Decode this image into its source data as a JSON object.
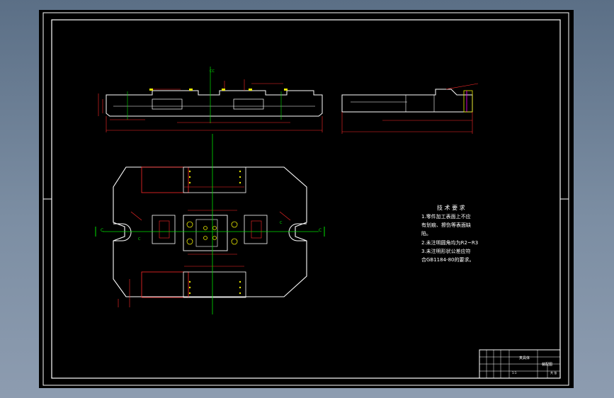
{
  "section_marks": {
    "top_view_label": "CC",
    "left_c": "C",
    "right_c": "C",
    "left_c_inner": "C",
    "right_c_inner": "C"
  },
  "technical_requirements": {
    "title": "技 术 要 求",
    "lines": [
      "1.零件加工表面上不应",
      "有划痕、擦伤等表面缺",
      "陷。",
      "2.未注明圆角均为R2~R3",
      "3.未注明形状公差应符",
      "合GB1184-80的要求。"
    ]
  },
  "title_block": {
    "part_name": "夹具体",
    "drawing_no": "装配图",
    "scale": "1:1",
    "sheet": "共 张"
  },
  "colors": {
    "outline": "#ffffff",
    "dimension": "#ff2a2a",
    "center_line": "#00e000",
    "accent": "#e8e800",
    "feature": "#ff00ff"
  }
}
